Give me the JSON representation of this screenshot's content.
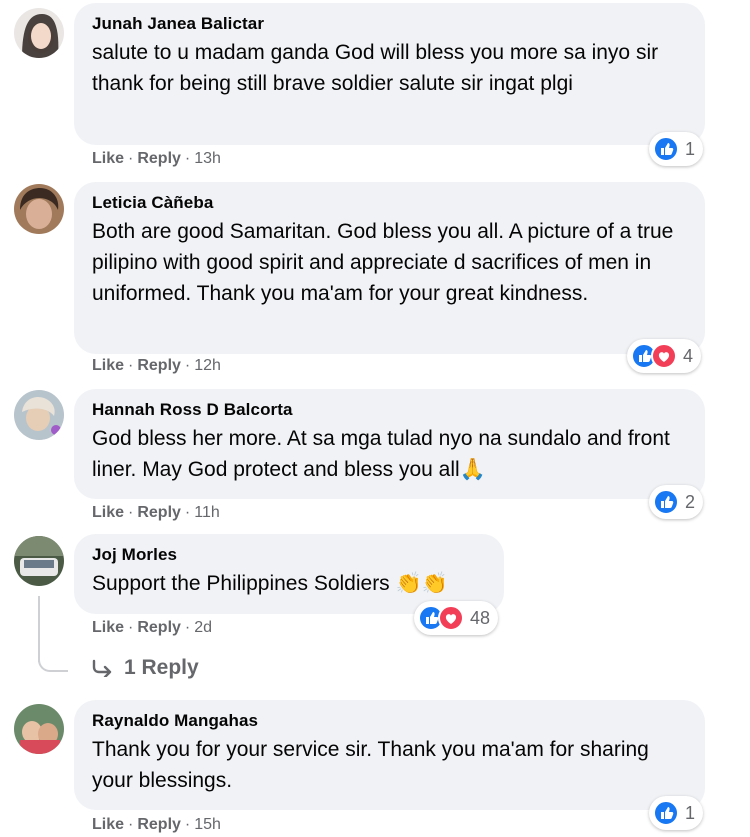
{
  "comments": [
    {
      "author": "Junah Janea Balictar",
      "text": "salute to u madam ganda God will bless you more sa inyo sir thank for being still brave soldier salute sir ingat plgi",
      "like_label": "Like",
      "reply_label": "Reply",
      "time": "13h",
      "reaction_count": "1"
    },
    {
      "author": "Leticia Càñeba",
      "text": "Both are good Samaritan. God bless you all. A picture of a true pilipino with good spirit and appreciate d sacrifices of men in uniformed. Thank you ma'am for your great kindness.",
      "like_label": "Like",
      "reply_label": "Reply",
      "time": "12h",
      "reaction_count": "4"
    },
    {
      "author": "Hannah Ross D Balcorta",
      "text": "God bless her more. At sa mga tulad nyo na sundalo and front liner. May God protect and bless you all🙏",
      "like_label": "Like",
      "reply_label": "Reply",
      "time": "11h",
      "reaction_count": "2"
    },
    {
      "author": "Joj Morles",
      "text": "Support the Philippines Soldiers 👏👏",
      "like_label": "Like",
      "reply_label": "Reply",
      "time": "2d",
      "reaction_count": "48"
    },
    {
      "author": "Raynaldo Mangahas",
      "text": "Thank you for your service sir. Thank you ma'am for sharing your blessings.",
      "like_label": "Like",
      "reply_label": "Reply",
      "time": "15h",
      "reaction_count": "1"
    }
  ],
  "replies_link": "1 Reply",
  "colors": {
    "bubble": "#f0f2f5",
    "like_blue": "#1877f2",
    "love_red": "#f33e58",
    "meta_gray": "#65676b"
  }
}
